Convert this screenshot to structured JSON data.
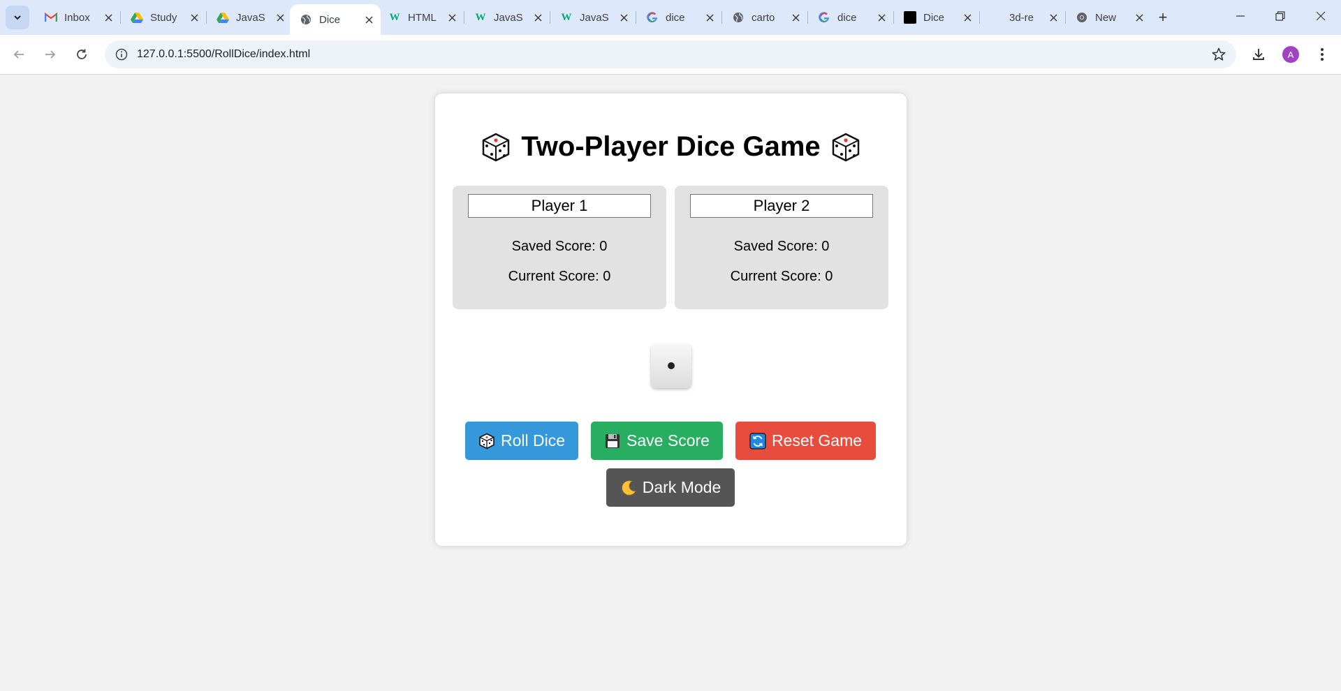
{
  "browser": {
    "tabs": [
      {
        "title": "Inbox",
        "favicon": "gmail-icon",
        "active": false
      },
      {
        "title": "Study",
        "favicon": "drive-icon",
        "active": false
      },
      {
        "title": "JavaS",
        "favicon": "drive-icon",
        "active": false
      },
      {
        "title": "Dice",
        "favicon": "globe-icon",
        "active": true
      },
      {
        "title": "HTML",
        "favicon": "w3schools-icon",
        "active": false
      },
      {
        "title": "JavaS",
        "favicon": "w3schools-icon",
        "active": false
      },
      {
        "title": "JavaS",
        "favicon": "w3schools-icon",
        "active": false
      },
      {
        "title": "dice",
        "favicon": "google-icon",
        "active": false
      },
      {
        "title": "carto",
        "favicon": "globe-icon",
        "active": false
      },
      {
        "title": "dice",
        "favicon": "google-icon",
        "active": false
      },
      {
        "title": "Dice",
        "favicon": "black-square-icon",
        "active": false
      },
      {
        "title": "3d-re",
        "favicon": "blank-icon",
        "active": false
      },
      {
        "title": "New",
        "favicon": "chrome-icon",
        "active": false
      }
    ],
    "url": "127.0.0.1:5500/RollDice/index.html",
    "profile_initial": "A"
  },
  "game": {
    "title": "Two-Player Dice Game",
    "players": [
      {
        "name": "Player 1",
        "saved_label": "Saved Score: 0",
        "current_label": "Current Score: 0"
      },
      {
        "name": "Player 2",
        "saved_label": "Saved Score: 0",
        "current_label": "Current Score: 0"
      }
    ],
    "die_value": 1,
    "buttons": {
      "roll": "Roll Dice",
      "save": "Save Score",
      "reset": "Reset Game",
      "dark": "Dark Mode"
    },
    "colors": {
      "roll": "#3498db",
      "save": "#27ae60",
      "reset": "#e74c3c",
      "dark": "#555555"
    }
  }
}
